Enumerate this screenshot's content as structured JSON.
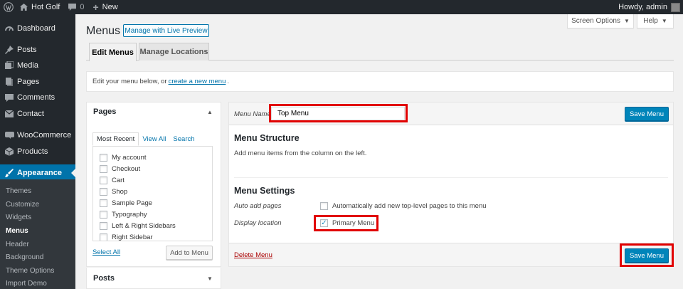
{
  "adminbar": {
    "site_name": "Hot Golf",
    "comments_count": "0",
    "new_label": "New",
    "howdy": "Howdy, admin"
  },
  "sidebar": {
    "items": [
      {
        "label": "Dashboard",
        "icon": "dashboard-icon"
      },
      {
        "label": "Posts",
        "icon": "pin-icon"
      },
      {
        "label": "Media",
        "icon": "media-icon"
      },
      {
        "label": "Pages",
        "icon": "page-icon"
      },
      {
        "label": "Comments",
        "icon": "comment-icon"
      },
      {
        "label": "Contact",
        "icon": "mail-icon"
      },
      {
        "label": "WooCommerce",
        "icon": "woo-icon"
      },
      {
        "label": "Products",
        "icon": "cube-icon"
      },
      {
        "label": "Appearance",
        "icon": "brush-icon"
      }
    ],
    "submenu": [
      "Themes",
      "Customize",
      "Widgets",
      "Menus",
      "Header",
      "Background",
      "Theme Options",
      "Import Demo"
    ],
    "current_submenu": "Menus"
  },
  "header": {
    "title": "Menus",
    "live_preview": "Manage with Live Preview",
    "screen_options": "Screen Options",
    "help": "Help"
  },
  "tabs": {
    "edit": "Edit Menus",
    "locations": "Manage Locations"
  },
  "notice": {
    "prefix": "Edit your menu below, or",
    "link": "create a new menu",
    "suffix": "."
  },
  "pages_box": {
    "title": "Pages",
    "tabs": [
      "Most Recent",
      "View All",
      "Search"
    ],
    "items": [
      "My account",
      "Checkout",
      "Cart",
      "Shop",
      "Sample Page",
      "Typography",
      "Left & Right Sidebars",
      "Right Sidebar"
    ],
    "select_all": "Select All",
    "add_button": "Add to Menu"
  },
  "posts_box": {
    "title": "Posts"
  },
  "menu_editor": {
    "name_label": "Menu Name",
    "name_value": "Top Menu",
    "save_label": "Save Menu",
    "structure_title": "Menu Structure",
    "structure_desc": "Add menu items from the column on the left.",
    "settings_title": "Menu Settings",
    "auto_add_label": "Auto add pages",
    "auto_add_text": "Automatically add new top-level pages to this menu",
    "auto_add_checked": false,
    "display_location_label": "Display location",
    "primary_menu_text": "Primary Menu",
    "primary_menu_checked": true,
    "delete_label": "Delete Menu"
  },
  "colors": {
    "admin_bar": "#23282d",
    "accent": "#0073aa",
    "button_primary": "#0085ba",
    "highlight": "#e10000",
    "delete": "#aa0000"
  }
}
